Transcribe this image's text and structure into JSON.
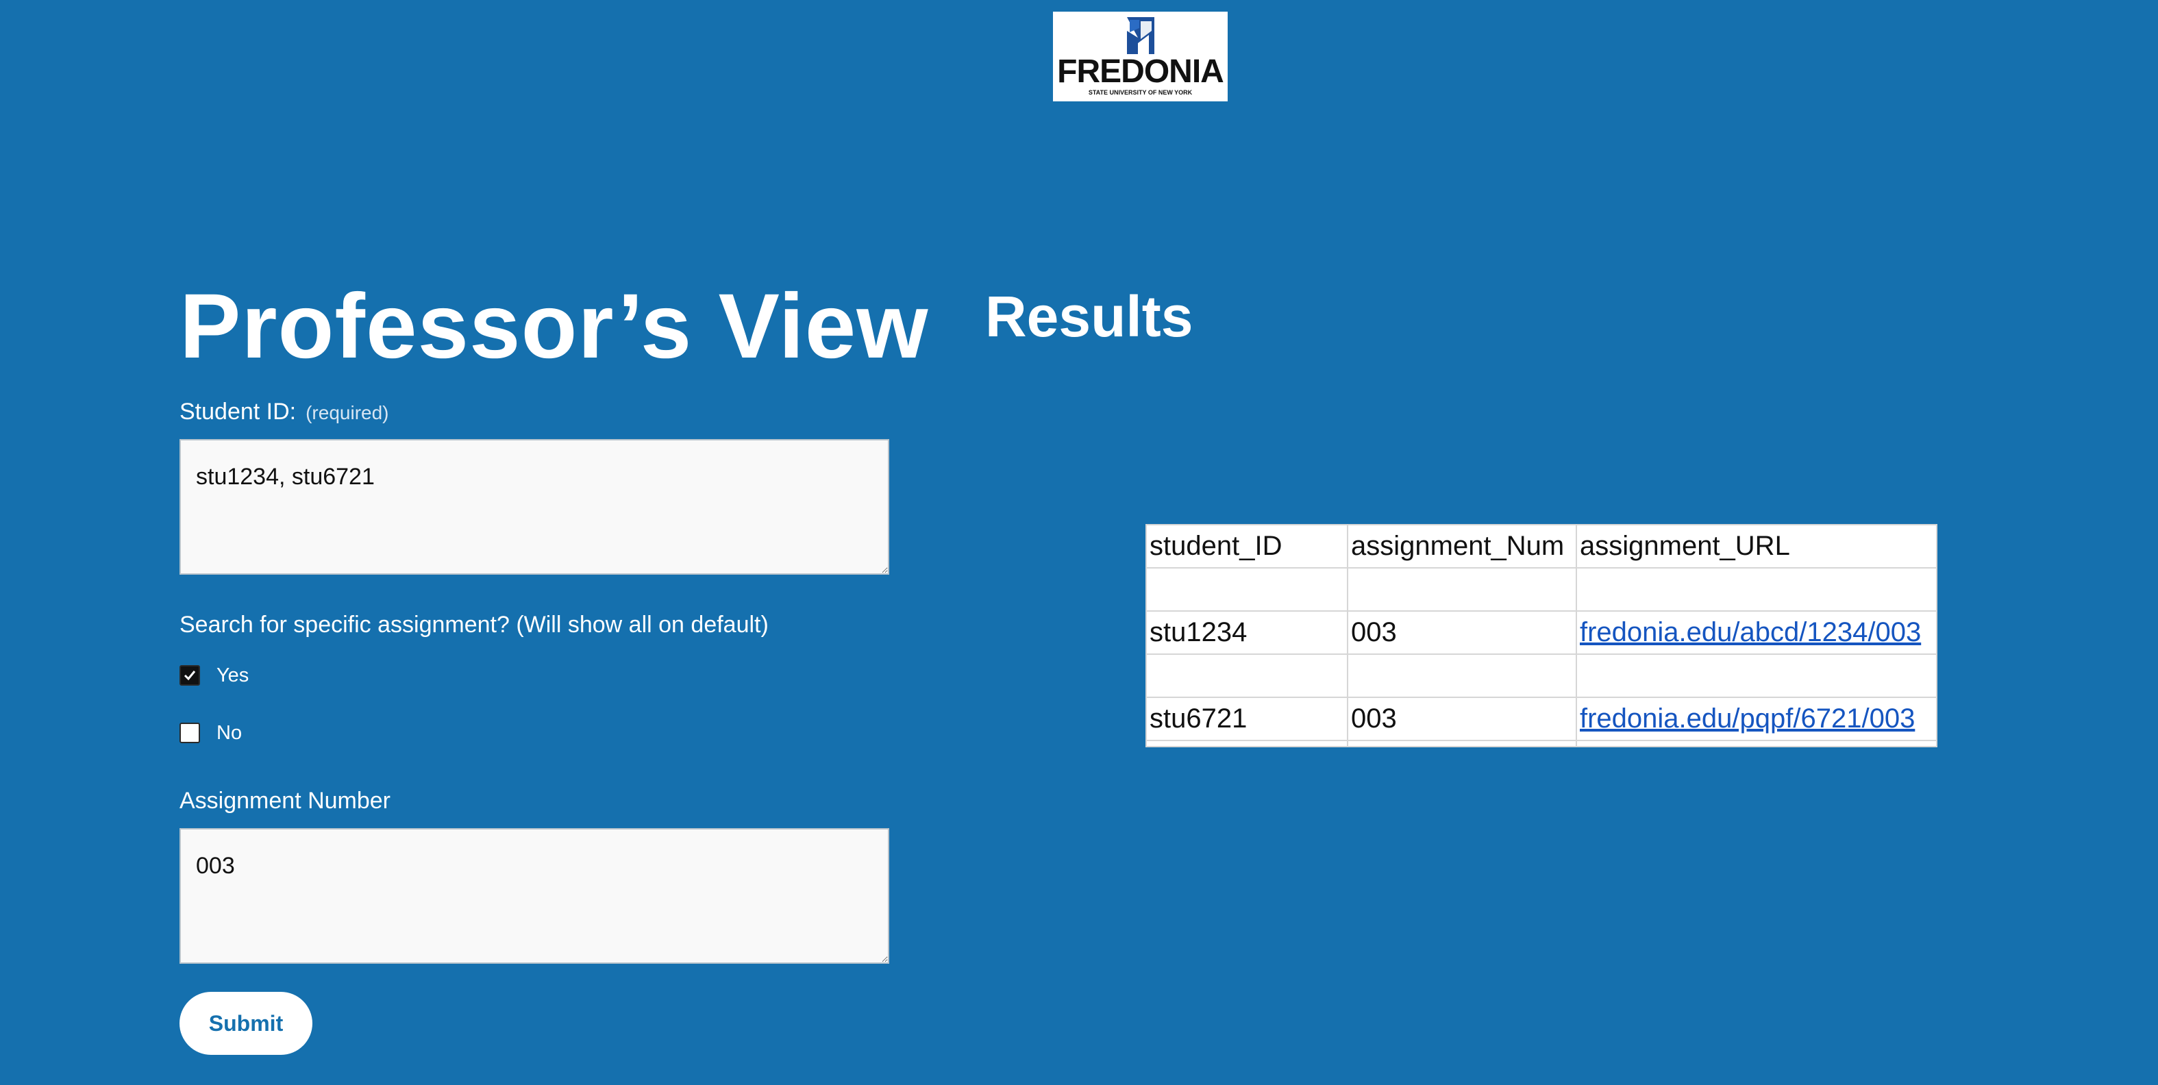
{
  "logo": {
    "name": "FREDONIA",
    "subtitle": "STATE UNIVERSITY OF NEW YORK"
  },
  "form": {
    "title": "Professor’s View",
    "student_id": {
      "label": "Student ID:",
      "hint": "(required)",
      "value": "stu1234, stu6721"
    },
    "assignment_search": {
      "question": "Search for specific assignment? (Will show all on default)",
      "options": [
        {
          "label": "Yes",
          "checked": true
        },
        {
          "label": "No",
          "checked": false
        }
      ]
    },
    "assignment_number": {
      "label": "Assignment Number",
      "value": "003"
    },
    "submit_label": "Submit"
  },
  "results": {
    "title": "Results",
    "columns": [
      "student_ID",
      "assignment_Num",
      "assignment_URL"
    ],
    "rows": [
      [
        "",
        "",
        ""
      ],
      [
        "stu1234",
        "003",
        "fredonia.edu/abcd/1234/003"
      ],
      [
        "",
        "",
        ""
      ],
      [
        "stu6721",
        "003",
        "fredonia.edu/pqpf/6721/003"
      ]
    ]
  },
  "colors": {
    "background": "#1570ae",
    "link": "#1555c0",
    "logo_mark": "#1d4f9a"
  },
  "icons": {
    "logo_mark": "fredonia-mark-icon",
    "checkbox_checked": "checkmark-icon",
    "resize_handle": "resize-grip-icon"
  }
}
